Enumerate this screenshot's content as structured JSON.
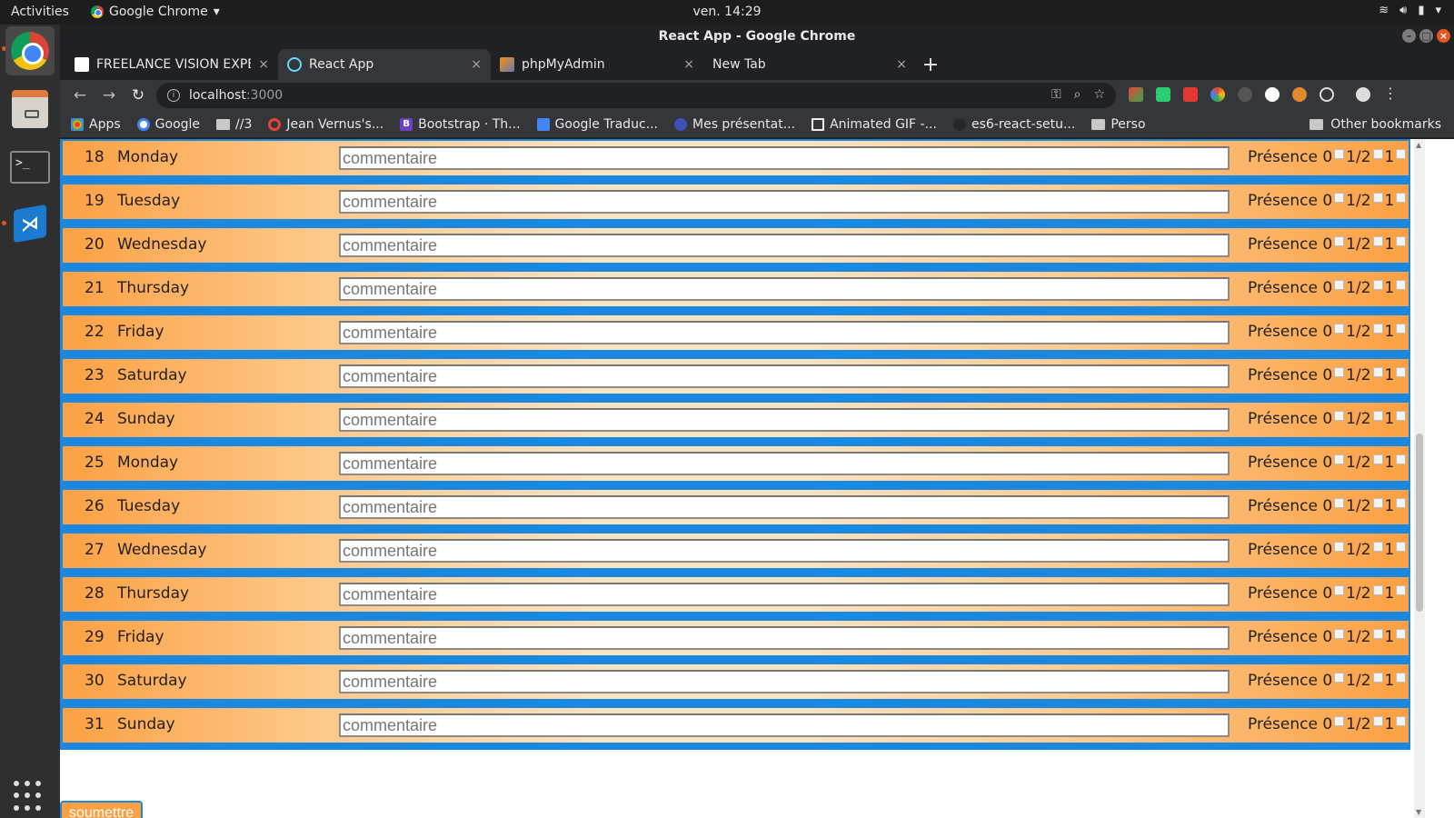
{
  "system_bar": {
    "activities": "Activities",
    "app_name": "Google Chrome",
    "clock": "ven. 14:29"
  },
  "window": {
    "title": "React App - Google Chrome"
  },
  "tabs": [
    {
      "label": "FREELANCE VISION EXPE",
      "active": false
    },
    {
      "label": "React App",
      "active": true
    },
    {
      "label": "phpMyAdmin",
      "active": false
    },
    {
      "label": "New Tab",
      "active": false
    }
  ],
  "address_bar": {
    "host": "localhost",
    "port": ":3000"
  },
  "bookmarks": [
    {
      "label": "Apps",
      "color": "#e94335"
    },
    {
      "label": "Google",
      "color": "#4285f4"
    },
    {
      "label": "//3",
      "color": "#c8c8c8"
    },
    {
      "label": "Jean Vernus's...",
      "color": "#e94335"
    },
    {
      "label": "Bootstrap · Th...",
      "color": "#6f42c1"
    },
    {
      "label": "Google Traduc...",
      "color": "#4285f4"
    },
    {
      "label": "Mes présentat...",
      "color": "#3f51b5"
    },
    {
      "label": "Animated GIF -...",
      "color": "#eeeeee"
    },
    {
      "label": "es6-react-setu...",
      "color": "#24292e"
    },
    {
      "label": "Perso",
      "color": "#c8c8c8"
    }
  ],
  "other_bookmarks": "Other bookmarks",
  "days": [
    {
      "num": "18",
      "day": "Monday"
    },
    {
      "num": "19",
      "day": "Tuesday"
    },
    {
      "num": "20",
      "day": "Wednesday"
    },
    {
      "num": "21",
      "day": "Thursday"
    },
    {
      "num": "22",
      "day": "Friday"
    },
    {
      "num": "23",
      "day": "Saturday"
    },
    {
      "num": "24",
      "day": "Sunday"
    },
    {
      "num": "25",
      "day": "Monday"
    },
    {
      "num": "26",
      "day": "Tuesday"
    },
    {
      "num": "27",
      "day": "Wednesday"
    },
    {
      "num": "28",
      "day": "Thursday"
    },
    {
      "num": "29",
      "day": "Friday"
    },
    {
      "num": "30",
      "day": "Saturday"
    },
    {
      "num": "31",
      "day": "Sunday"
    }
  ],
  "row_labels": {
    "comment_placeholder": "commentaire",
    "presence": "Présence",
    "opt_0": "0",
    "opt_half": "1/2",
    "opt_1": "1"
  },
  "submit_label": "soumettre",
  "colors": {
    "row_border": "#1a87e0",
    "row_fill": "#fca043",
    "ubuntu_accent": "#e95420"
  }
}
